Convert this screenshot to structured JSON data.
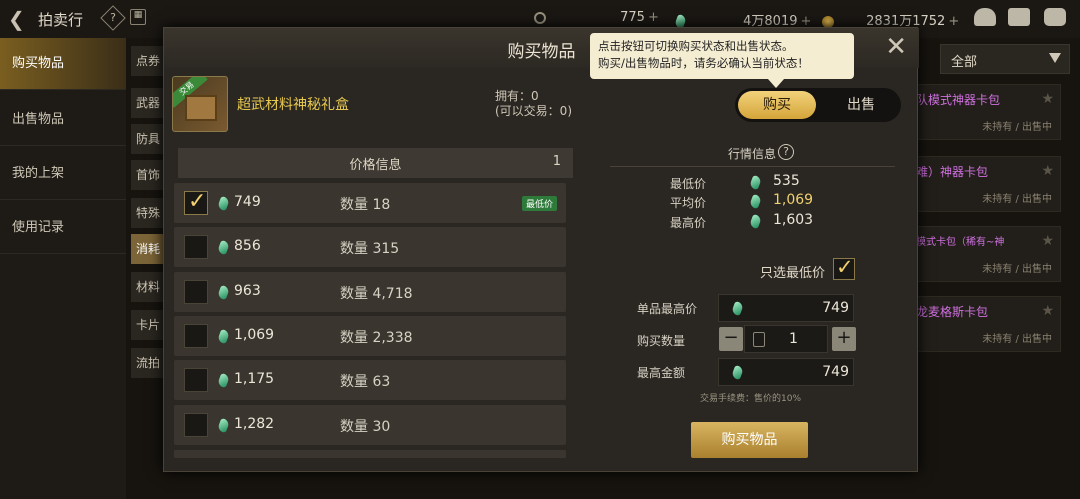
{
  "topbar": {
    "title": "拍卖行",
    "help": "?",
    "calendar": "▦",
    "c_amount": "775",
    "gem_amount": "4万8019",
    "gold_amount": "2831万1752"
  },
  "sidebar": {
    "items": [
      {
        "label": "购买物品"
      },
      {
        "label": "出售物品"
      },
      {
        "label": "我的上架"
      },
      {
        "label": "使用记录"
      }
    ]
  },
  "categories": [
    "点券",
    "武器",
    "防具",
    "首饰",
    "特殊",
    "消耗",
    "材料",
    "卡片",
    "流拍"
  ],
  "right_panel": {
    "dropdown": "全部",
    "cards": [
      {
        "name": "队模式神器卡包",
        "status": "未持有 / 出售中"
      },
      {
        "name": "难）神器卡包",
        "status": "未持有 / 出售中"
      },
      {
        "name": "模式卡包（稀有~神",
        "status": "未持有 / 出售中"
      },
      {
        "name": "龙麦格斯卡包",
        "status": "未持有 / 出售中"
      }
    ]
  },
  "modal": {
    "title": "购买物品",
    "tooltip_line1": "点击按钮可切换购买状态和出售状态。",
    "tooltip_line2": "购买/出售物品时，请务必确认当前状态！",
    "item_tag": "交易",
    "item_name": "超武材料神秘礼盒",
    "owned": "拥有：0",
    "tradable": "(可以交易：0)",
    "toggle_buy": "购买",
    "toggle_sell": "出售",
    "price_header": "价格信息",
    "price_header_count": "1",
    "qty_label": "数量",
    "lowest_badge": "最低价",
    "listings": [
      {
        "price": "749",
        "qty": "18",
        "checked": true
      },
      {
        "price": "856",
        "qty": "315",
        "checked": false
      },
      {
        "price": "963",
        "qty": "4,718",
        "checked": false
      },
      {
        "price": "1,069",
        "qty": "2,338",
        "checked": false
      },
      {
        "price": "1,175",
        "qty": "63",
        "checked": false
      },
      {
        "price": "1,282",
        "qty": "30",
        "checked": false
      }
    ],
    "market": {
      "title": "行情信息",
      "min_label": "最低价",
      "min_value": "535",
      "avg_label": "平均价",
      "avg_value": "1,069",
      "max_label": "最高价",
      "max_value": "1,603"
    },
    "only_lowest": "只选最低价",
    "unit_max_label": "单品最高价",
    "unit_max_value": "749",
    "buy_qty_label": "购买数量",
    "buy_qty_value": "1",
    "total_label": "最高金额",
    "total_value": "749",
    "fee": "交易手续费：售价的10%",
    "buy_button": "购买物品"
  }
}
